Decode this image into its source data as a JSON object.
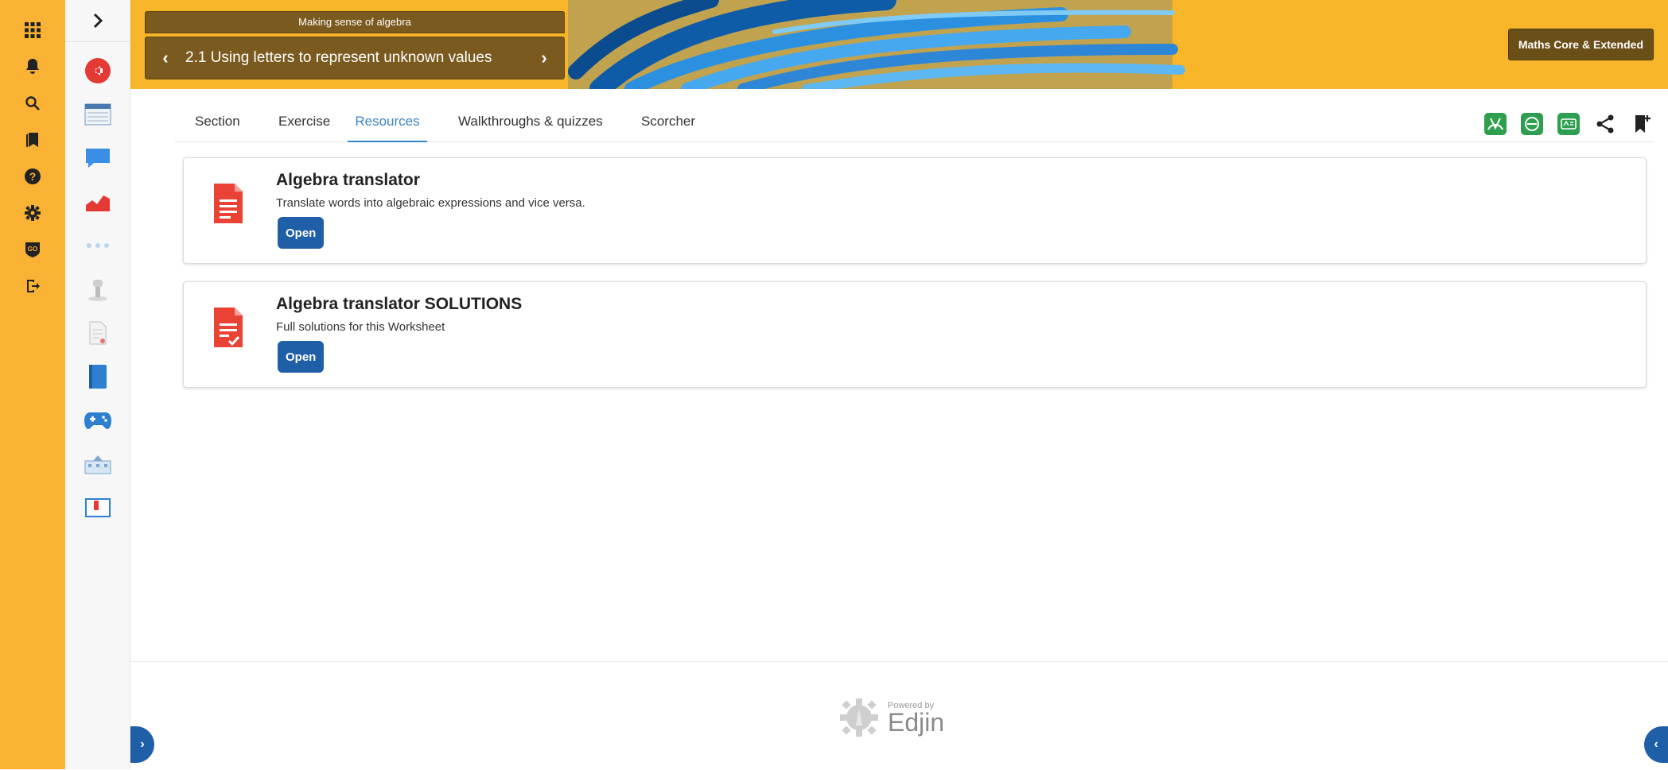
{
  "banner": {
    "topic_caption": "Making sense of algebra",
    "topic_title": "2.1 Using letters to represent unknown values",
    "course_badge": "Maths Core & Extended"
  },
  "tabs": [
    {
      "label": "Section"
    },
    {
      "label": "Exercise"
    },
    {
      "label": "Resources"
    },
    {
      "label": "Walkthroughs & quizzes"
    },
    {
      "label": "Scorcher"
    }
  ],
  "resources": [
    {
      "title": "Algebra translator",
      "description": "Translate words into algebraic expressions and vice versa.",
      "button": "Open"
    },
    {
      "title": "Algebra translator SOLUTIONS",
      "description": "Full solutions for this Worksheet",
      "button": "Open"
    }
  ],
  "footer": {
    "powered_by": "Powered by",
    "brand": "Edjin"
  },
  "colors": {
    "rail": "#f9b233",
    "accent": "#3b84c4",
    "button": "#1f5fa8",
    "banner": "#f7b52a"
  }
}
